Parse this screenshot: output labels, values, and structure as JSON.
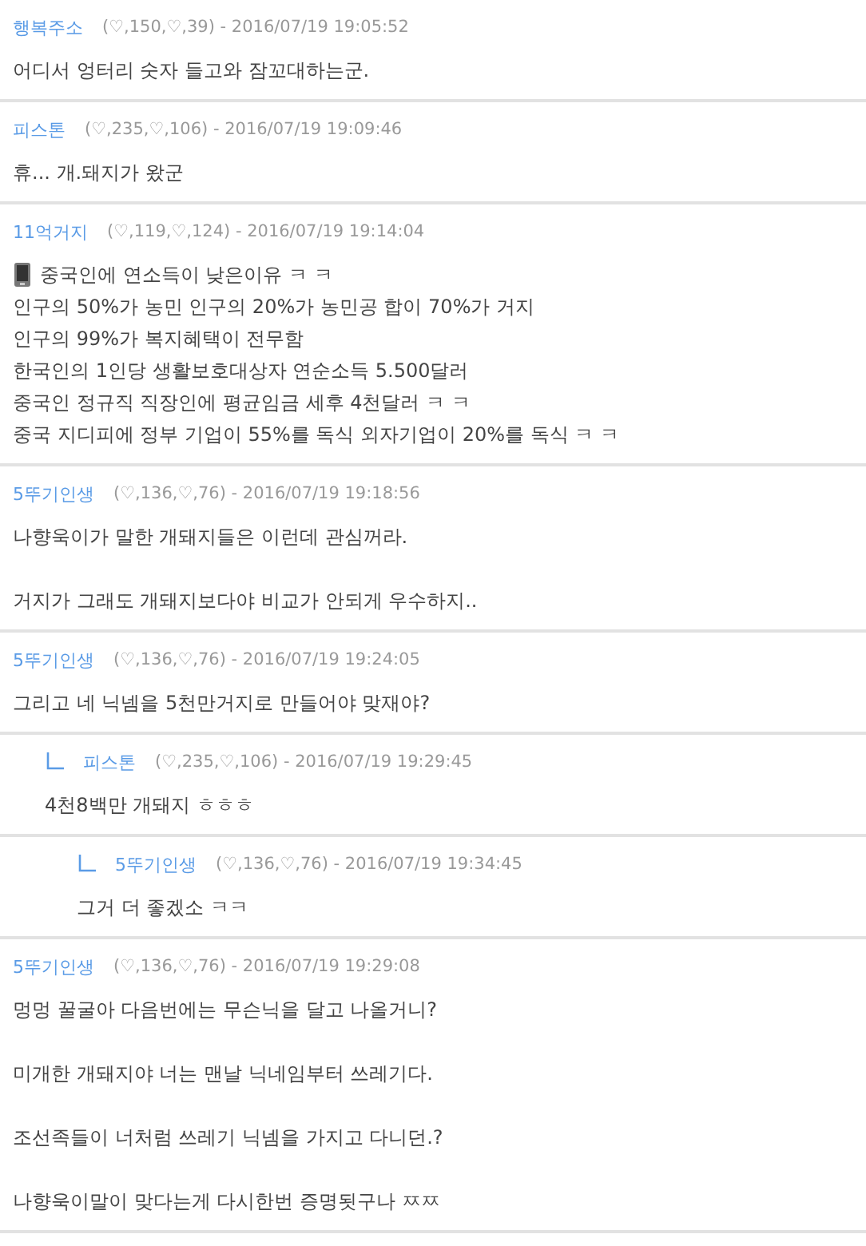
{
  "comments": [
    {
      "author": "행복주소",
      "meta": "(♡,150,♡,39) - 2016/07/19 19:05:52",
      "paragraphs": [
        [
          "어디서 엉터리 숫자 들고와 잠꼬대하는군."
        ]
      ]
    },
    {
      "author": "피스톤",
      "meta": "(♡,235,♡,106) - 2016/07/19 19:09:46",
      "paragraphs": [
        [
          "휴... 개.돼지가 왔군"
        ]
      ]
    },
    {
      "author": "11억거지",
      "meta": "(♡,119,♡,124) - 2016/07/19 19:14:04",
      "leading_icon": true,
      "paragraphs": [
        [
          "중국인에 연소득이 낮은이유 ㅋ ㅋ",
          "인구의 50%가 농민 인구의 20%가 농민공 합이 70%가 거지",
          "인구의 99%가 복지혜택이 전무함",
          "한국인의 1인당 생활보호대상자 연순소득 5.500달러",
          "중국인 정규직 직장인에 평균임금 세후 4천달러 ㅋ ㅋ",
          "중국 지디피에 정부 기업이 55%를 독식 외자기업이 20%를 독식 ㅋ ㅋ"
        ]
      ]
    },
    {
      "author": "5뚜기인생",
      "meta": "(♡,136,♡,76) - 2016/07/19 19:18:56",
      "paragraphs": [
        [
          "나향욱이가 말한 개돼지들은 이런데 관심꺼라."
        ],
        [
          "거지가 그래도 개돼지보다야 비교가 안되게 우수하지.."
        ]
      ]
    },
    {
      "author": "5뚜기인생",
      "meta": "(♡,136,♡,76) - 2016/07/19 19:24:05",
      "paragraphs": [
        [
          "그리고 네 닉넴을 5천만거지로 만들어야 맞재야?"
        ]
      ],
      "children": [
        {
          "author": "피스톤",
          "meta": "(♡,235,♡,106) - 2016/07/19 19:29:45",
          "paragraphs": [
            [
              "4천8백만 개돼지 ㅎㅎㅎ"
            ]
          ],
          "children": [
            {
              "author": "5뚜기인생",
              "meta": "(♡,136,♡,76) - 2016/07/19 19:34:45",
              "paragraphs": [
                [
                  "그거 더 좋겠소 ㅋㅋ"
                ]
              ]
            }
          ]
        }
      ]
    },
    {
      "author": "5뚜기인생",
      "meta": "(♡,136,♡,76) - 2016/07/19 19:29:08",
      "paragraphs": [
        [
          "멍멍 꿀굴아 다음번에는 무슨닉을 달고 나올거니?"
        ],
        [
          "미개한 개돼지야 너는 맨날 닉네임부터 쓰레기다."
        ],
        [
          "조선족들이 너처럼 쓰레기 닉넴을 가지고 다니던.?"
        ],
        [
          "나향욱이말이 맞다는게 다시한번 증명됫구나 ㅉㅉ"
        ]
      ]
    }
  ]
}
